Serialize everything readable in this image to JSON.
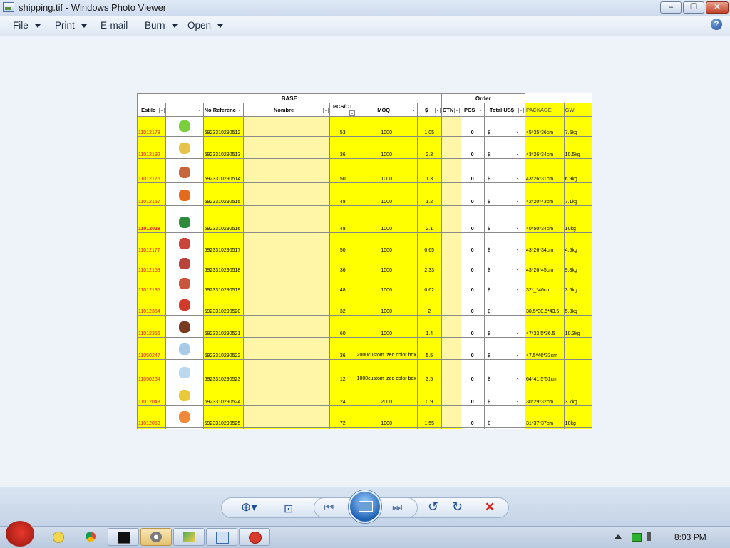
{
  "window": {
    "title": "shipping.tif - Windows Photo Viewer",
    "min": "‒",
    "max": "❐",
    "close": "✕"
  },
  "menu": [
    {
      "label": "File",
      "has_caret": true
    },
    {
      "label": "Print",
      "has_caret": true
    },
    {
      "label": "E-mail",
      "has_caret": false
    },
    {
      "label": "Burn",
      "has_caret": true
    },
    {
      "label": "Open",
      "has_caret": true
    }
  ],
  "help": "?",
  "sheet": {
    "group_headers": {
      "base": "BASE",
      "order": "Order"
    },
    "columns": [
      "Estilo",
      "",
      "No Referenc",
      "Nombre",
      "PCS/CT",
      "MOQ",
      "$",
      "CTN",
      "PCS",
      "Total US$",
      "PACKAGE",
      "GW"
    ],
    "rows": [
      {
        "estilo": "11012178",
        "ref": "6923310290512",
        "pcs": "53",
        "moq": "1000",
        "price": "1.05",
        "order_pcs": "0",
        "cur": "$",
        "total": "-",
        "package": "45*35*36cm",
        "gw": "7.5kg",
        "thumb": "#7bcf3c"
      },
      {
        "estilo": "11012192",
        "ref": "6923310290513",
        "pcs": "36",
        "moq": "1000",
        "price": "2.3",
        "order_pcs": "0",
        "cur": "$",
        "total": "-",
        "package": "43*26*34cm",
        "gw": "10.5kg",
        "thumb": "#e7c34a"
      },
      {
        "estilo": "11012175",
        "ref": "6923310290514",
        "pcs": "50",
        "moq": "1000",
        "price": "1.3",
        "order_pcs": "0",
        "cur": "$",
        "total": "-",
        "package": "43*26*31cm",
        "gw": "6.9kg",
        "thumb": "#c9653b"
      },
      {
        "estilo": "11012157",
        "ref": "6923310290515",
        "pcs": "48",
        "moq": "1000",
        "price": "1.2",
        "order_pcs": "0",
        "cur": "$",
        "total": "-",
        "package": "42*20*43cm",
        "gw": "7.1kg",
        "thumb": "#e46a1c"
      },
      {
        "estilo": "11012028",
        "ref": "6923310290516",
        "pcs": "48",
        "moq": "1000",
        "price": "2.1",
        "order_pcs": "0",
        "cur": "$",
        "total": "-",
        "package": "40*50*34cm",
        "gw": "10kg",
        "thumb": "#2e8b3a"
      },
      {
        "estilo": "11012177",
        "ref": "6923310290517",
        "pcs": "50",
        "moq": "1000",
        "price": "0.65",
        "order_pcs": "0",
        "cur": "$",
        "total": "-",
        "package": "43*26*34cm",
        "gw": "4.5kg",
        "thumb": "#c9453b"
      },
      {
        "estilo": "11012153",
        "ref": "6923310290518",
        "pcs": "36",
        "moq": "1000",
        "price": "2.33",
        "order_pcs": "0",
        "cur": "$",
        "total": "-",
        "package": "43*26*45cm",
        "gw": "9.8kg",
        "thumb": "#b8443a"
      },
      {
        "estilo": "11012135",
        "ref": "6923310290519",
        "pcs": "48",
        "moq": "1000",
        "price": "0.62",
        "order_pcs": "0",
        "cur": "$",
        "total": "-",
        "package": "32*_*46cm",
        "gw": "3.6kg",
        "thumb": "#c9553b"
      },
      {
        "estilo": "11012354",
        "ref": "6923310290520",
        "pcs": "32",
        "moq": "1000",
        "price": "2",
        "order_pcs": "0",
        "cur": "$",
        "total": "-",
        "package": "30.5*30.5*43.5",
        "gw": "5.8kg",
        "thumb": "#d23a2a"
      },
      {
        "estilo": "11012356",
        "ref": "6923310290521",
        "pcs": "60",
        "moq": "1000",
        "price": "1.4",
        "order_pcs": "0",
        "cur": "$",
        "total": "-",
        "package": "47*33.5*36.5",
        "gw": "10.3kg",
        "thumb": "#7a3a22"
      },
      {
        "estilo": "11050247",
        "ref": "6923310290522",
        "pcs": "36",
        "moq": "2000custom ized color box",
        "price": "5.5",
        "order_pcs": "0",
        "cur": "$",
        "total": "-",
        "package": "47.5*46*33cm",
        "gw": "",
        "thumb": "#a9c9e8"
      },
      {
        "estilo": "11050254",
        "ref": "6923310290523",
        "pcs": "12",
        "moq": "1000custom ized color box",
        "price": "3.5",
        "order_pcs": "0",
        "cur": "$",
        "total": "-",
        "package": "64*41.5*51cm",
        "gw": "",
        "thumb": "#bcd8ee"
      },
      {
        "estilo": "11012048",
        "ref": "6923310290524",
        "pcs": "24",
        "moq": "2000",
        "price": "0.9",
        "order_pcs": "0",
        "cur": "$",
        "total": "-",
        "package": "30*29*32cm",
        "gw": "3.7kg",
        "thumb": "#e9c93a"
      },
      {
        "estilo": "11012053",
        "ref": "6923310290525",
        "pcs": "72",
        "moq": "1000",
        "price": "1.55",
        "order_pcs": "0",
        "cur": "$",
        "total": "-",
        "package": "31*37*37cm",
        "gw": "10kg",
        "thumb": "#f08a3a"
      }
    ]
  },
  "toolbar": {
    "zoom": "⊕▾",
    "fit": "⊡",
    "prev": "⏮",
    "next": "⏭",
    "rotate_ccw": "↺",
    "rotate_cw": "↻",
    "delete": "✕"
  },
  "taskbar": {
    "time": "8:03 PM"
  },
  "colors": {
    "sheet_yellow": "#ffff00",
    "estilo_red": "#e02020",
    "delete_red": "#d0241c"
  }
}
